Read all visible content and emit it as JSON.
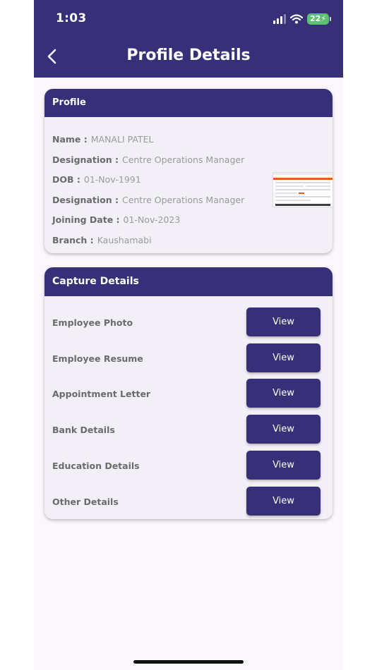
{
  "status_bar": {
    "time": "1:03",
    "battery": "22"
  },
  "header": {
    "title": "Profile Details"
  },
  "profile": {
    "heading": "Profile",
    "fields": [
      {
        "label": "Name :",
        "value": "MANALI PATEL"
      },
      {
        "label": "Designation :",
        "value": "Centre Operations Manager"
      },
      {
        "label": "DOB :",
        "value": "01-Nov-1991"
      },
      {
        "label": "Designation :",
        "value": "Centre Operations Manager"
      },
      {
        "label": "Joining Date :",
        "value": "01-Nov-2023"
      },
      {
        "label": "Branch :",
        "value": "Kaushamabi"
      }
    ]
  },
  "capture": {
    "heading": "Capture Details",
    "items": [
      {
        "label": "Employee Photo",
        "button": "View"
      },
      {
        "label": "Employee Resume",
        "button": "View"
      },
      {
        "label": "Appointment Letter",
        "button": "View"
      },
      {
        "label": "Bank Details",
        "button": "View"
      },
      {
        "label": "Education Details",
        "button": "View"
      },
      {
        "label": "Other Details",
        "button": "View"
      }
    ]
  },
  "colors": {
    "primary": "#373078",
    "background": "#fcf7fc",
    "card": "#f3eff7",
    "battery": "#5cc26b"
  },
  "icons": {
    "back": "chevron-left-icon",
    "signal": "cellular-signal-icon",
    "wifi": "wifi-icon",
    "battery": "battery-charging-icon"
  }
}
